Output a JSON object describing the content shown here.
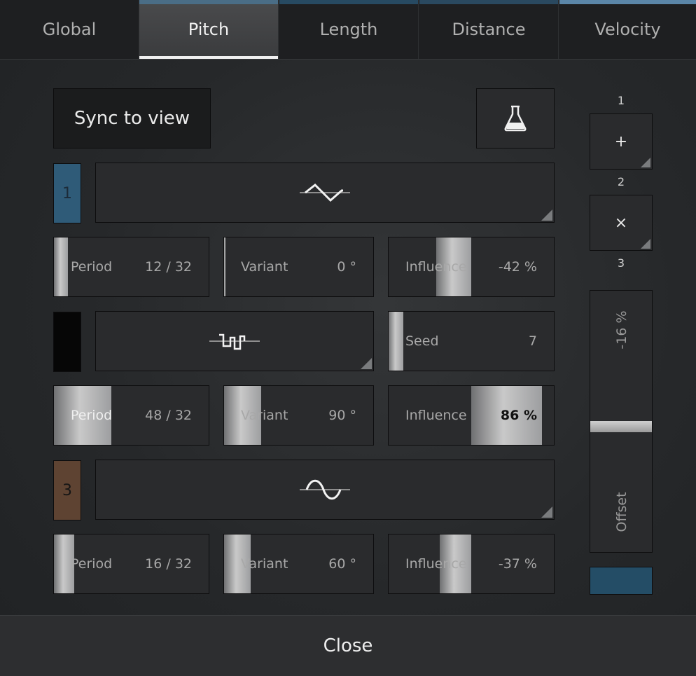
{
  "tabs": [
    {
      "label": "Global",
      "color": "#1e1f21",
      "active": false
    },
    {
      "label": "Pitch",
      "color": "#4a6d86",
      "active": true
    },
    {
      "label": "Length",
      "color": "#274a62",
      "active": false
    },
    {
      "label": "Distance",
      "color": "#2a4960",
      "active": false
    },
    {
      "label": "Velocity",
      "color": "#5b86a8",
      "active": false
    }
  ],
  "toolbar": {
    "sync_label": "Sync to view",
    "flask_icon": "flask-icon"
  },
  "lanes": [
    {
      "number": "1",
      "color": "#2f5b78",
      "wave_icon": "sawtooth-wave-icon",
      "params": [
        {
          "label": "Period",
          "value": "12 / 32",
          "fraction": 0.09
        },
        {
          "label": "Variant",
          "value": "0 °",
          "fraction": 0.0
        },
        {
          "label": "Influence",
          "value": "-42 %",
          "fraction": 0.21
        }
      ]
    },
    {
      "number": "",
      "color": "#060606",
      "wave_icon": "random-step-wave-icon",
      "seed": {
        "label": "Seed",
        "value": "7",
        "fraction": 0.09
      },
      "params": [
        {
          "label": "Period",
          "value": "48 / 32",
          "fraction": 0.37
        },
        {
          "label": "Variant",
          "value": "90 °",
          "fraction": 0.25
        },
        {
          "label": "Influence",
          "value": "86 %",
          "fraction": 0.43
        }
      ]
    },
    {
      "number": "3",
      "color": "#5e4332",
      "wave_icon": "sine-wave-icon",
      "params": [
        {
          "label": "Period",
          "value": "16 / 32",
          "fraction": 0.13
        },
        {
          "label": "Variant",
          "value": "60 °",
          "fraction": 0.18
        },
        {
          "label": "Influence",
          "value": "-37 %",
          "fraction": 0.19
        }
      ]
    }
  ],
  "side": {
    "labels": [
      "1",
      "2",
      "3"
    ],
    "add_label": "+",
    "multiply_label": "×",
    "offset": {
      "label": "Offset",
      "value": "-16 %",
      "fraction": 0.42
    },
    "block_color": "#244d66"
  },
  "footer": {
    "close_label": "Close"
  }
}
